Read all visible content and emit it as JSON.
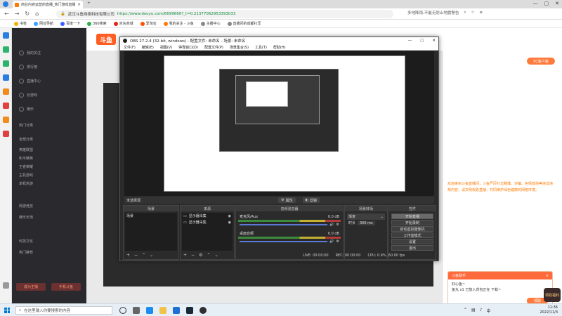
{
  "browser": {
    "tab_title": "商业内容运营的直播_热门游戏直播",
    "new_tab": "+",
    "tab_close": "×",
    "window_controls": [
      "—",
      "▢",
      "✕"
    ],
    "url_site": "武汉斗鱼网络科技有限公司",
    "url": "https://www.douyu.com/6699660?_t=0.21377062953393033",
    "addr_right": "多地降雨:不能无防止地震警告",
    "bookmarks": [
      "书签",
      "网址导航",
      "百度一下",
      "360搜索",
      "京东商城",
      "爱淘宝",
      "我的关注 - 斗鱼",
      "主播中心",
      "直播间的成都打压"
    ]
  },
  "douyu": {
    "logo": "斗鱼",
    "sidebar": {
      "items": [
        "我的关注",
        "排行榜",
        "直播中心",
        "云游戏",
        "娱乐",
        "热门分类",
        "全部分类",
        "英雄联盟",
        "和平精英",
        "王者荣耀",
        "主机游戏",
        "单机热游",
        "网游竞技",
        "娱乐天地",
        "科技文化",
        "热门推荐"
      ],
      "btn_left": "成为主播",
      "btn_right": "手机斗鱼"
    },
    "right_panel": {
      "btn": "PC客户端",
      "chat": "欢迎来到斗鱼直播间，斗鱼严厉打击赌博、诈骗、色情低俗等违法违规内容，请文明观看直播，共同维护绿色健康的网络环境。"
    },
    "popup": {
      "title": "斗鱼助手",
      "close": "×",
      "line1": "好心鱼~",
      "line2": "鱼丸 x1 已放入背包正在 下载~",
      "btn": "领取",
      "gift": "领取福利"
    }
  },
  "obs": {
    "title": "OBS 27.2.4 (32-bit, windows) - 配置文件: 未命名 - 场景: 未命名",
    "menu": [
      "文件(F)",
      "编辑(E)",
      "视图(V)",
      "停靠窗口(D)",
      "配置文件(P)",
      "场景集合(S)",
      "工具(T)",
      "帮助(H)"
    ],
    "no_scene": "未选择源",
    "props_btn": "属性",
    "filter_btn": "滤镜",
    "docks": {
      "scenes": {
        "head": "场景",
        "items": [
          "场景"
        ]
      },
      "sources": {
        "head": "来源",
        "items": [
          "显示器采集",
          "显示器采集"
        ]
      },
      "mixer": {
        "head": "音频混音器",
        "tracks": [
          {
            "name": "麦克风/Aux",
            "level": "0.0 dB"
          },
          {
            "name": "桌面音频",
            "level": "0.0 dB"
          }
        ]
      },
      "transitions": {
        "head": "场景转场",
        "type": "渐变",
        "duration_label": "时长",
        "duration": "300 ms"
      },
      "controls": {
        "head": "控件",
        "buttons": [
          "开始直播",
          "开始录制",
          "启动虚拟摄像机",
          "工作室模式",
          "设置",
          "退出"
        ]
      }
    },
    "status": [
      "LIVE: 00:00:00",
      "REC: 00:00:00",
      "CPU: 0.9%, 60.00 fps"
    ]
  },
  "taskbar": {
    "search_placeholder": "在这里输入你要搜索的内容",
    "time": "11:36",
    "date": "2022/11/3",
    "lang": "中"
  },
  "colors": {
    "accent": "#ff5d23",
    "obs_bg": "#2b2b2b",
    "sidebar_bg": "#2a2a2e"
  }
}
